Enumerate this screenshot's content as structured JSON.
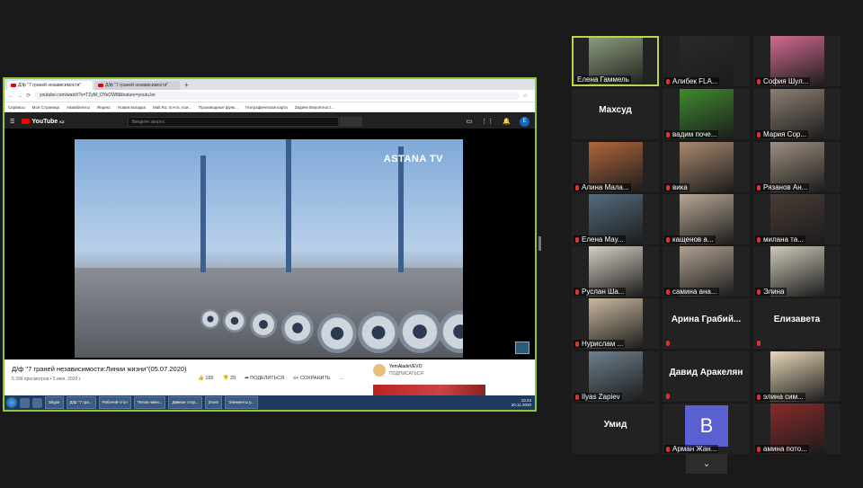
{
  "browser": {
    "tabs": [
      {
        "label": "Д/ф \"7 граней независимости\""
      },
      {
        "label": "Д/ф \"7 граней независимости\""
      }
    ],
    "new_tab": "+",
    "url": "youtube.com/watch?v=TZyM_OYeOW8&feature=youtu.be",
    "bookmarks": [
      "Сервисы",
      "Моя Страница",
      "Авиабилеты",
      "Яндекс",
      "Новая вкладка",
      "Mail.Ru: почта, пои...",
      "Производные функ...",
      "Географическая карта",
      "Задачи Вероятност..."
    ]
  },
  "youtube": {
    "logo": "YouTube",
    "logo_suffix": "KZ",
    "search_placeholder": "Введите запрос",
    "avatar_letter": "E",
    "watermark": "ASTANA TV",
    "video_title": "Д/ф \"7 граней независимости:Линии жизни\"(05.07.2020)",
    "video_meta": "5 399 просмотров • 5 июл. 2020 г.",
    "likes": "165",
    "dislikes": "29",
    "share": "ПОДЕЛИТЬСЯ",
    "save": "СОХРАНИТЬ",
    "more": "...",
    "channel": "YemAladeVEVO",
    "subscribe": "ПОДПИСАТЬСЯ"
  },
  "taskbar": {
    "items": [
      "Skype",
      "Д/ф \"7 гра...",
      "Рабочий стол",
      "Пегов нижи...",
      "Дивизи стор...",
      "Zoom",
      "Элементы у..."
    ],
    "time": "13:24",
    "date": "20.11.2020"
  },
  "participants": [
    {
      "name": "Елена Гаммель",
      "type": "video",
      "active": true,
      "muted": false,
      "color": "#8a9a7a"
    },
    {
      "name": "Алибек FLA...",
      "type": "video",
      "muted": true,
      "color": "#2a2a2a"
    },
    {
      "name": "София Шул...",
      "type": "video",
      "muted": true,
      "color": "#d46a92"
    },
    {
      "name": "Махсуд",
      "type": "name"
    },
    {
      "name": "вадим поче...",
      "type": "video",
      "muted": true,
      "color": "#3f8a2f"
    },
    {
      "name": "Мария Сор...",
      "type": "video",
      "muted": true,
      "color": "#8c7f73"
    },
    {
      "name": "Алина Мала...",
      "type": "video",
      "muted": true,
      "color": "#b0663c"
    },
    {
      "name": "вика",
      "type": "video",
      "muted": true,
      "color": "#a88a6f"
    },
    {
      "name": "Рязанов Ан...",
      "type": "video",
      "muted": true,
      "color": "#9e8f80"
    },
    {
      "name": "Елена Мау...",
      "type": "video",
      "muted": true,
      "color": "#556b7e"
    },
    {
      "name": "кащенов а...",
      "type": "video",
      "muted": true,
      "color": "#b8a894"
    },
    {
      "name": "милана та...",
      "type": "video",
      "muted": true,
      "color": "#4a3c36"
    },
    {
      "name": "Руслан Ша...",
      "type": "video",
      "muted": true,
      "color": "#d6cfc4"
    },
    {
      "name": "самина ана...",
      "type": "video",
      "muted": true,
      "color": "#b0a090"
    },
    {
      "name": "Элина",
      "type": "video",
      "muted": true,
      "color": "#cfc9b8"
    },
    {
      "name": "Нурислам ...",
      "type": "video",
      "muted": true,
      "color": "#c9b89e"
    },
    {
      "name": "Арина Грабий...",
      "type": "name",
      "muted": true
    },
    {
      "name": "Елизавета",
      "type": "name",
      "muted": true
    },
    {
      "name": "Ilyas Zapiev",
      "type": "video",
      "muted": true,
      "color": "#6e7f8c"
    },
    {
      "name": "Давид Аракелян",
      "type": "name",
      "muted": true
    },
    {
      "name": "элина сим...",
      "type": "video",
      "muted": true,
      "color": "#e9d8b8"
    },
    {
      "name": "Умид",
      "type": "name"
    },
    {
      "name": "Арман Жан...",
      "type": "avatar",
      "letter": "B",
      "muted": true
    },
    {
      "name": "амина пото...",
      "type": "video",
      "muted": true,
      "color": "#8a2a2a"
    }
  ],
  "more_chevron": "⌄"
}
